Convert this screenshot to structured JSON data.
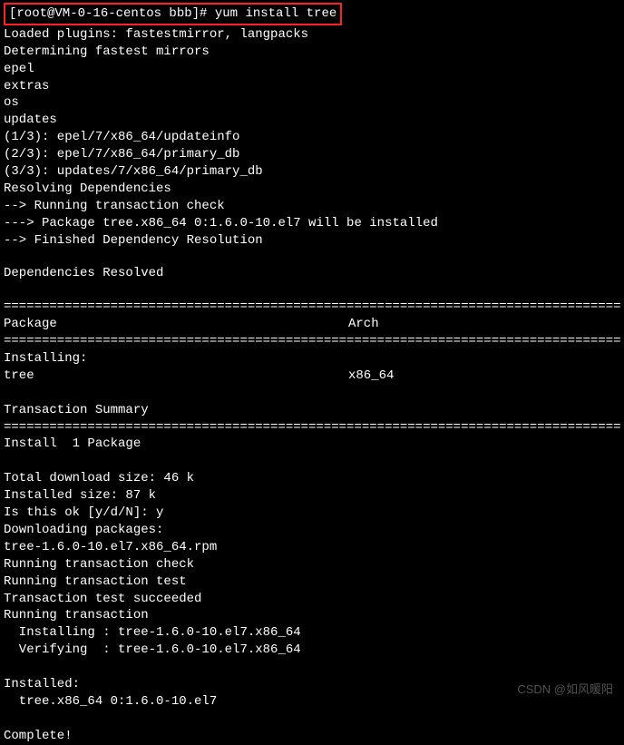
{
  "prompt": "[root@VM-0-16-centos bbb]# yum install tree",
  "lines": {
    "l1": "Loaded plugins: fastestmirror, langpacks",
    "l2": "Determining fastest mirrors",
    "l3": "epel",
    "l4": "extras",
    "l5": "os",
    "l6": "updates",
    "l7": "(1/3): epel/7/x86_64/updateinfo",
    "l8": "(2/3): epel/7/x86_64/primary_db",
    "l9": "(3/3): updates/7/x86_64/primary_db",
    "l10": "Resolving Dependencies",
    "l11": "--> Running transaction check",
    "l12": "---> Package tree.x86_64 0:1.6.0-10.el7 will be installed",
    "l13": "--> Finished Dependency Resolution",
    "l14": "",
    "l15": "Dependencies Resolved",
    "l16": "",
    "headerPkg": " Package",
    "headerArch": "Arch",
    "installingLabel": "Installing:",
    "pkgName": " tree",
    "pkgArch": "x86_64",
    "txSummary": "Transaction Summary",
    "installCount": "Install  1 Package",
    "dlSize": "Total download size: 46 k",
    "instSize": "Installed size: 87 k",
    "confirm": "Is this ok [y/d/N]: y",
    "downloading": "Downloading packages:",
    "rpm": "tree-1.6.0-10.el7.x86_64.rpm",
    "runCheck": "Running transaction check",
    "runTest": "Running transaction test",
    "testOk": "Transaction test succeeded",
    "runTx": "Running transaction",
    "installingPkg": "  Installing : tree-1.6.0-10.el7.x86_64",
    "verifyingPkg": "  Verifying  : tree-1.6.0-10.el7.x86_64",
    "installedLabel": "Installed:",
    "installedPkg": "  tree.x86_64 0:1.6.0-10.el7",
    "complete": "Complete!"
  },
  "sep": "================================================================================================",
  "watermark": "CSDN @如风暖阳"
}
